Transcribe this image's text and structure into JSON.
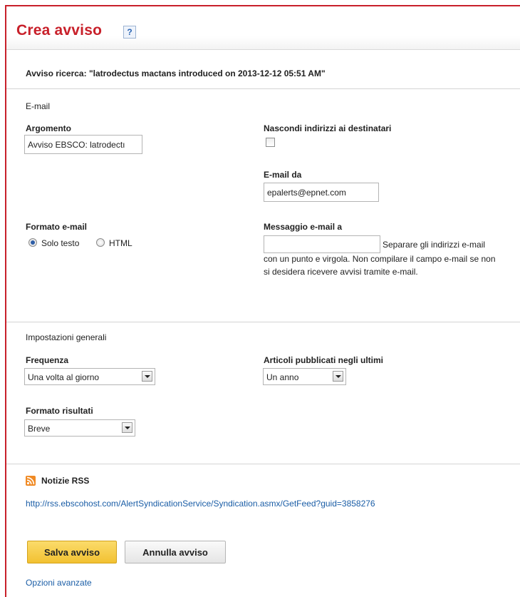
{
  "header": {
    "title": "Crea avviso",
    "help_label": "?"
  },
  "alert": {
    "line": "Avviso ricerca: \"latrodectus mactans introduced on 2013-12-12 05:51 AM\""
  },
  "email_section": {
    "title": "E-mail",
    "subject_label": "Argomento",
    "subject_value": "Avviso EBSCO: latrodectı",
    "hide_addresses_label": "Nascondi indirizzi ai destinatari",
    "hide_addresses_checked": false,
    "from_label": "E-mail da",
    "from_value": "epalerts@epnet.com",
    "format_label": "Formato e-mail",
    "format_options": [
      {
        "label": "Solo testo",
        "selected": true
      },
      {
        "label": "HTML",
        "selected": false
      }
    ],
    "to_label": "Messaggio e-mail a",
    "to_value": "",
    "to_help": "Separare gli indirizzi e-mail con un punto e virgola. Non compilare il campo e-mail se non si desidera ricevere avvisi tramite e-mail."
  },
  "general_section": {
    "title": "Impostazioni generali",
    "frequency_label": "Frequenza",
    "frequency_value": "Una volta al giorno",
    "published_label": "Articoli pubblicati negli ultimi",
    "published_value": "Un anno",
    "results_format_label": "Formato risultati",
    "results_format_value": "Breve"
  },
  "rss": {
    "title": "Notizie RSS",
    "icon": "rss-feed-icon",
    "url": "http://rss.ebscohost.com/AlertSyndicationService/Syndication.asmx/GetFeed?guid=3858276"
  },
  "actions": {
    "save_label": "Salva avviso",
    "cancel_label": "Annulla avviso",
    "advanced_label": "Opzioni avanzate"
  },
  "colors": {
    "title_red": "#c8202a",
    "link_blue": "#1a5da6",
    "save_button_yellow": "#f2c131",
    "rss_orange": "#f08a24"
  }
}
